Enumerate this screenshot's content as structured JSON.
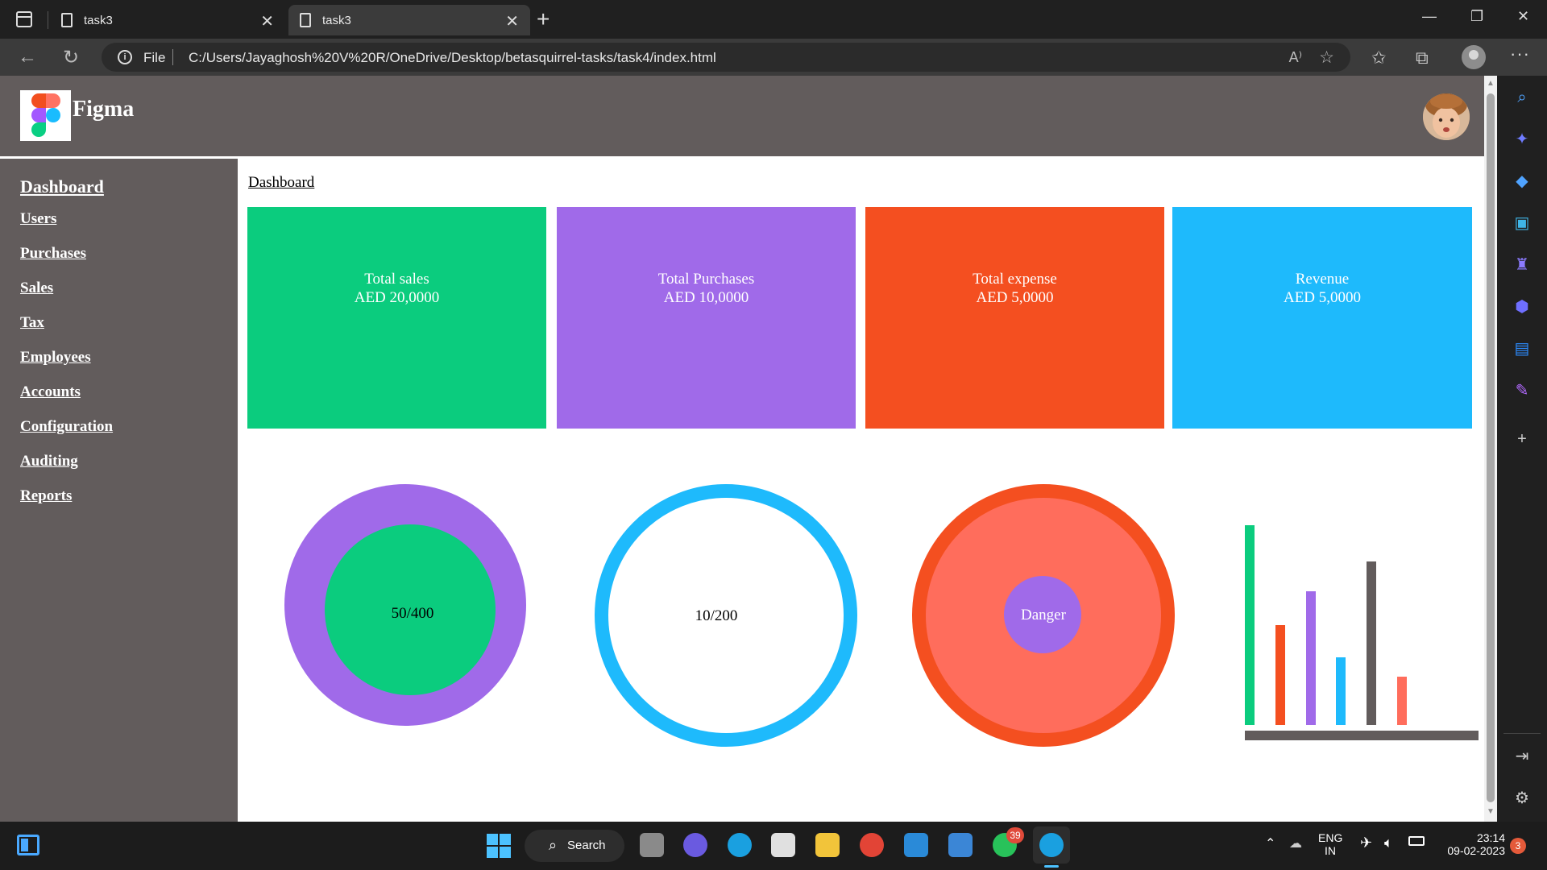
{
  "browser": {
    "tabs": [
      {
        "title": "task3",
        "active": false
      },
      {
        "title": "task3",
        "active": true
      }
    ],
    "address": {
      "scheme_label": "File",
      "url": "C:/Users/Jayaghosh%20V%20R/OneDrive/Desktop/betasquirrel-tasks/task4/index.html"
    }
  },
  "app": {
    "brand": "Figma",
    "breadcrumb": "Dashboard",
    "sidebar": [
      "Dashboard",
      "Users",
      "Purchases",
      "Sales",
      "Tax",
      "Employees",
      "Accounts",
      "Configuration",
      "Auditing",
      "Reports"
    ],
    "cards": [
      {
        "title": "Total sales",
        "value": "AED 20,0000",
        "color": "#0bcc7e"
      },
      {
        "title": "Total Purchases",
        "value": "AED 10,0000",
        "color": "#a06ae9"
      },
      {
        "title": "Total expense",
        "value": "AED 5,0000",
        "color": "#f44f20"
      },
      {
        "title": "Revenue",
        "value": "AED 5,0000",
        "color": "#1ebafc"
      }
    ],
    "gauges": {
      "sales_ratio": "50/400",
      "purchase_ratio": "10/200",
      "danger": "Danger"
    },
    "colors": {
      "header_bg": "#625c5c",
      "green": "#0bcc7e",
      "purple": "#a06ae9",
      "orange": "#f44f20",
      "blue": "#1ebafc",
      "coral": "#ff6d5c"
    },
    "bar_chart": {
      "values": [
        100,
        50,
        67,
        34,
        82,
        24
      ],
      "colors": [
        "#0bcc7e",
        "#f44f20",
        "#a06ae9",
        "#1ebafc",
        "#625c5c",
        "#ff6d5c"
      ]
    }
  },
  "taskbar": {
    "search_label": "Search",
    "whatsapp_badge": "39",
    "lang_top": "ENG",
    "lang_bottom": "IN",
    "time": "23:14",
    "date": "09-02-2023",
    "notif_count": "3"
  }
}
